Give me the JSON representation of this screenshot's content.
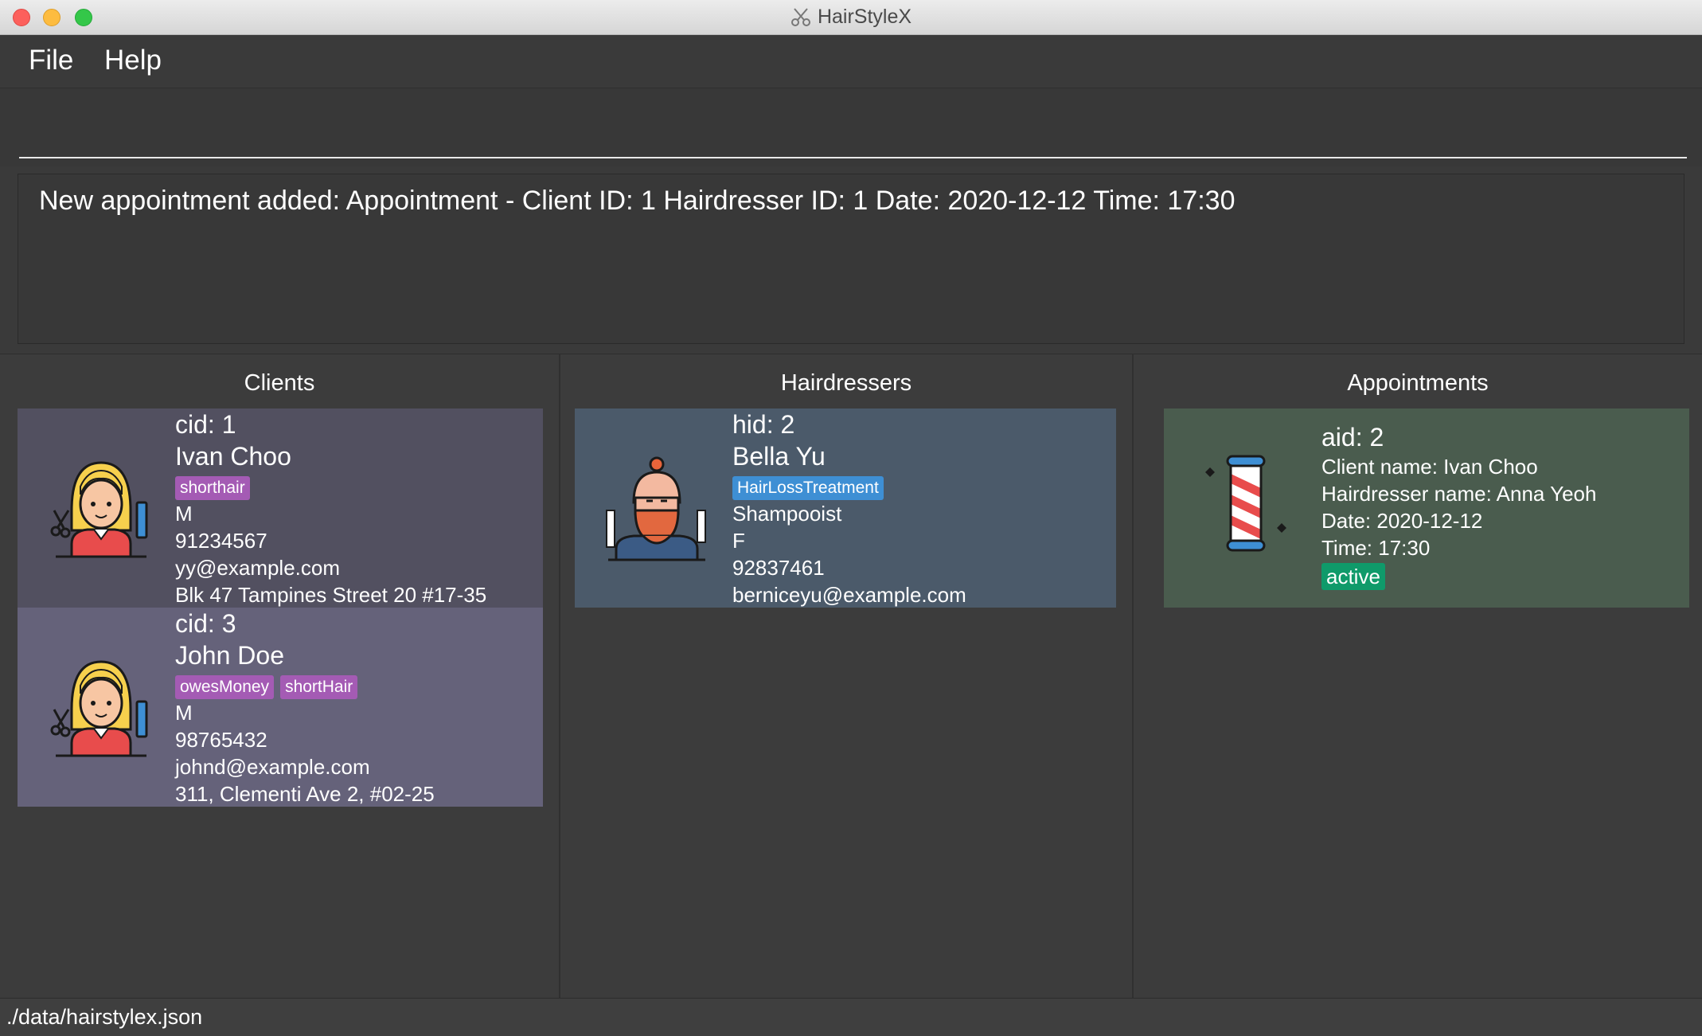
{
  "window": {
    "title": "HairStyleX"
  },
  "menu": {
    "file": "File",
    "help": "Help"
  },
  "command": {
    "value": ""
  },
  "result": {
    "message": "New appointment added: Appointment - Client ID: 1 Hairdresser ID: 1 Date: 2020-12-12 Time: 17:30"
  },
  "columns": {
    "clients": "Clients",
    "hairdressers": "Hairdressers",
    "appointments": "Appointments"
  },
  "clients": [
    {
      "id": "cid: 1",
      "name": "Ivan Choo",
      "tags": [
        "shorthair"
      ],
      "gender": "M",
      "phone": "91234567",
      "email": "yy@example.com",
      "address": "Blk 47 Tampines Street 20 #17-35"
    },
    {
      "id": "cid: 3",
      "name": "John Doe",
      "tags": [
        "owesMoney",
        "shortHair"
      ],
      "gender": "M",
      "phone": "98765432",
      "email": "johnd@example.com",
      "address": "311, Clementi Ave 2, #02-25"
    }
  ],
  "hairdressers": [
    {
      "id": "hid: 2",
      "name": "Bella Yu",
      "tags": [
        "HairLossTreatment"
      ],
      "title": "Shampooist",
      "gender": "F",
      "phone": "92837461",
      "email": "berniceyu@example.com"
    }
  ],
  "appointments": [
    {
      "id": "aid: 2",
      "client": "Client name:  Ivan Choo",
      "hairdresser": "Hairdresser name: Anna Yeoh",
      "date": "Date: 2020-12-12",
      "time": "Time: 17:30",
      "status": "active"
    }
  ],
  "status": {
    "path": "./data/hairstylex.json"
  },
  "colors": {
    "client_card_1": "#525060",
    "client_card_2": "#65627a",
    "hairdresser_card": "#4b5a6a",
    "appointment_card": "#4a5c4e",
    "tag_purple": "#a45bb4",
    "tag_blue": "#3e8fd4",
    "tag_active": "#0f9a6a"
  }
}
